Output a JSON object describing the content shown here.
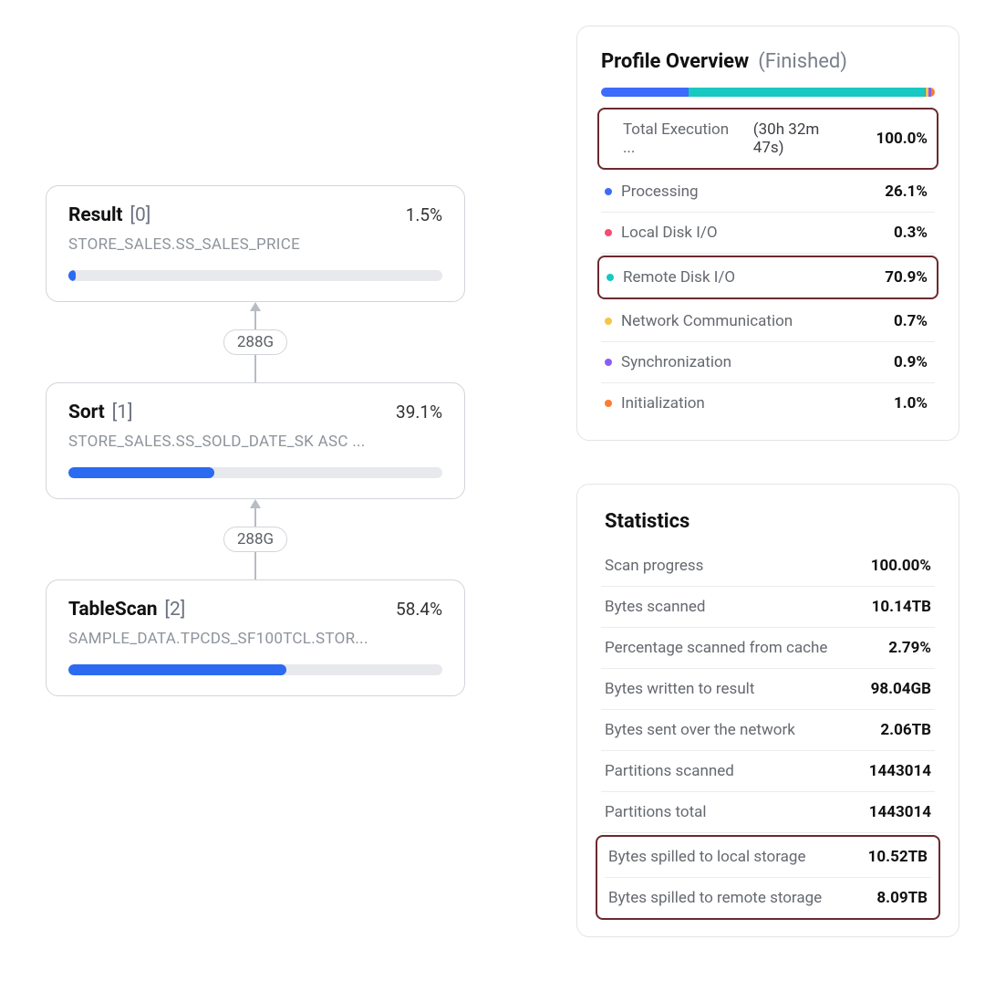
{
  "graph": {
    "nodes": [
      {
        "title": "Result",
        "idx": "[0]",
        "pct": "1.5%",
        "sub": "STORE_SALES.SS_SALES_PRICE",
        "bar_pct": 1.5
      },
      {
        "title": "Sort",
        "idx": "[1]",
        "pct": "39.1%",
        "sub": "STORE_SALES.SS_SOLD_DATE_SK ASC ...",
        "bar_pct": 39.1
      },
      {
        "title": "TableScan",
        "idx": "[2]",
        "pct": "58.4%",
        "sub": "SAMPLE_DATA.TPCDS_SF100TCL.STOR...",
        "bar_pct": 58.4
      }
    ],
    "edges": [
      {
        "label": "288G"
      },
      {
        "label": "288G"
      }
    ]
  },
  "profile": {
    "title": "Profile Overview",
    "status": "(Finished)",
    "bar": [
      {
        "color": "#3d6bfb",
        "pct": 26.1
      },
      {
        "color": "#18c8c1",
        "pct": 70.9
      },
      {
        "color": "#f64d6e",
        "pct": 0.3
      },
      {
        "color": "#f2c744",
        "pct": 0.7
      },
      {
        "color": "#8b5cf6",
        "pct": 0.9
      },
      {
        "color": "#ff7a2f",
        "pct": 1.0
      }
    ],
    "rows": [
      {
        "dot": null,
        "label": "Total Execution ...",
        "dur": "(30h 32m 47s)",
        "pct": "100.0%",
        "hl": true
      },
      {
        "dot": "#3d6bfb",
        "label": "Processing",
        "dur": "",
        "pct": "26.1%",
        "hl": false
      },
      {
        "dot": "#f64d6e",
        "label": "Local Disk I/O",
        "dur": "",
        "pct": "0.3%",
        "hl": false
      },
      {
        "dot": "#18c8c1",
        "label": "Remote Disk I/O",
        "dur": "",
        "pct": "70.9%",
        "hl": true
      },
      {
        "dot": "#f2c744",
        "label": "Network Communication",
        "dur": "",
        "pct": "0.7%",
        "hl": false
      },
      {
        "dot": "#8b5cf6",
        "label": "Synchronization",
        "dur": "",
        "pct": "0.9%",
        "hl": false
      },
      {
        "dot": "#ff7a2f",
        "label": "Initialization",
        "dur": "",
        "pct": "1.0%",
        "hl": false
      }
    ]
  },
  "stats": {
    "title": "Statistics",
    "rows": [
      {
        "label": "Scan progress",
        "value": "100.00%"
      },
      {
        "label": "Bytes scanned",
        "value": "10.14TB"
      },
      {
        "label": "Percentage scanned from cache",
        "value": "2.79%"
      },
      {
        "label": "Bytes written to result",
        "value": "98.04GB"
      },
      {
        "label": "Bytes sent over the network",
        "value": "2.06TB"
      },
      {
        "label": "Partitions scanned",
        "value": "1443014"
      },
      {
        "label": "Partitions total",
        "value": "1443014"
      },
      {
        "label": "Bytes spilled to local storage",
        "value": "10.52TB"
      },
      {
        "label": "Bytes spilled to remote storage",
        "value": "8.09TB"
      }
    ],
    "hl_group_start": 7
  }
}
